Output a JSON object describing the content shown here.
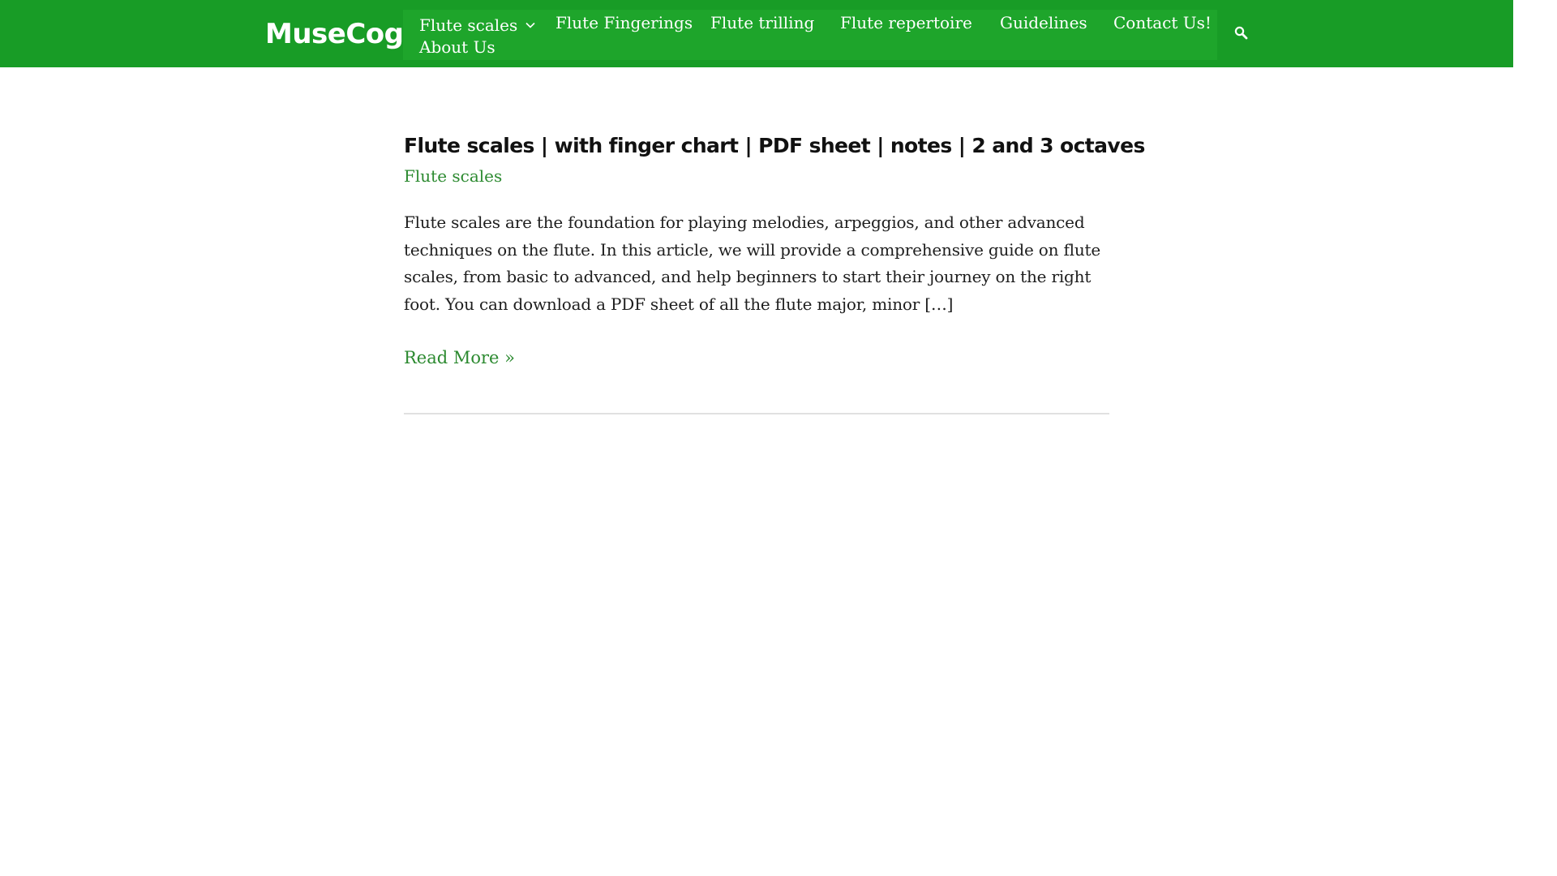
{
  "site": {
    "logo": "MuseCog"
  },
  "nav": {
    "items": [
      {
        "label": "Flute scales",
        "has_dropdown": true
      },
      {
        "label": "Flute Fingerings"
      },
      {
        "label": "Flute trilling"
      },
      {
        "label": "Flute repertoire"
      },
      {
        "label": "Guidelines"
      },
      {
        "label": "Contact Us!"
      },
      {
        "label": "About Us"
      }
    ],
    "search_icon": "search-icon"
  },
  "post": {
    "title": "Flute scales | with finger chart | PDF sheet | notes | 2 and 3 octaves",
    "category": "Flute scales",
    "excerpt": "Flute scales are the foundation for playing melodies, arpeggios, and other advanced techniques on the flute. In this article, we will provide a comprehensive guide on flute scales, from basic to advanced, and help beginners to start their journey on the right foot. You can download a PDF sheet of all the flute major, minor […]",
    "read_more": "Read More »"
  },
  "colors": {
    "header_bg": "#189c26",
    "nav_bg": "#1ea52b",
    "link": "#2c8a30",
    "text": "#1e1e1e"
  }
}
